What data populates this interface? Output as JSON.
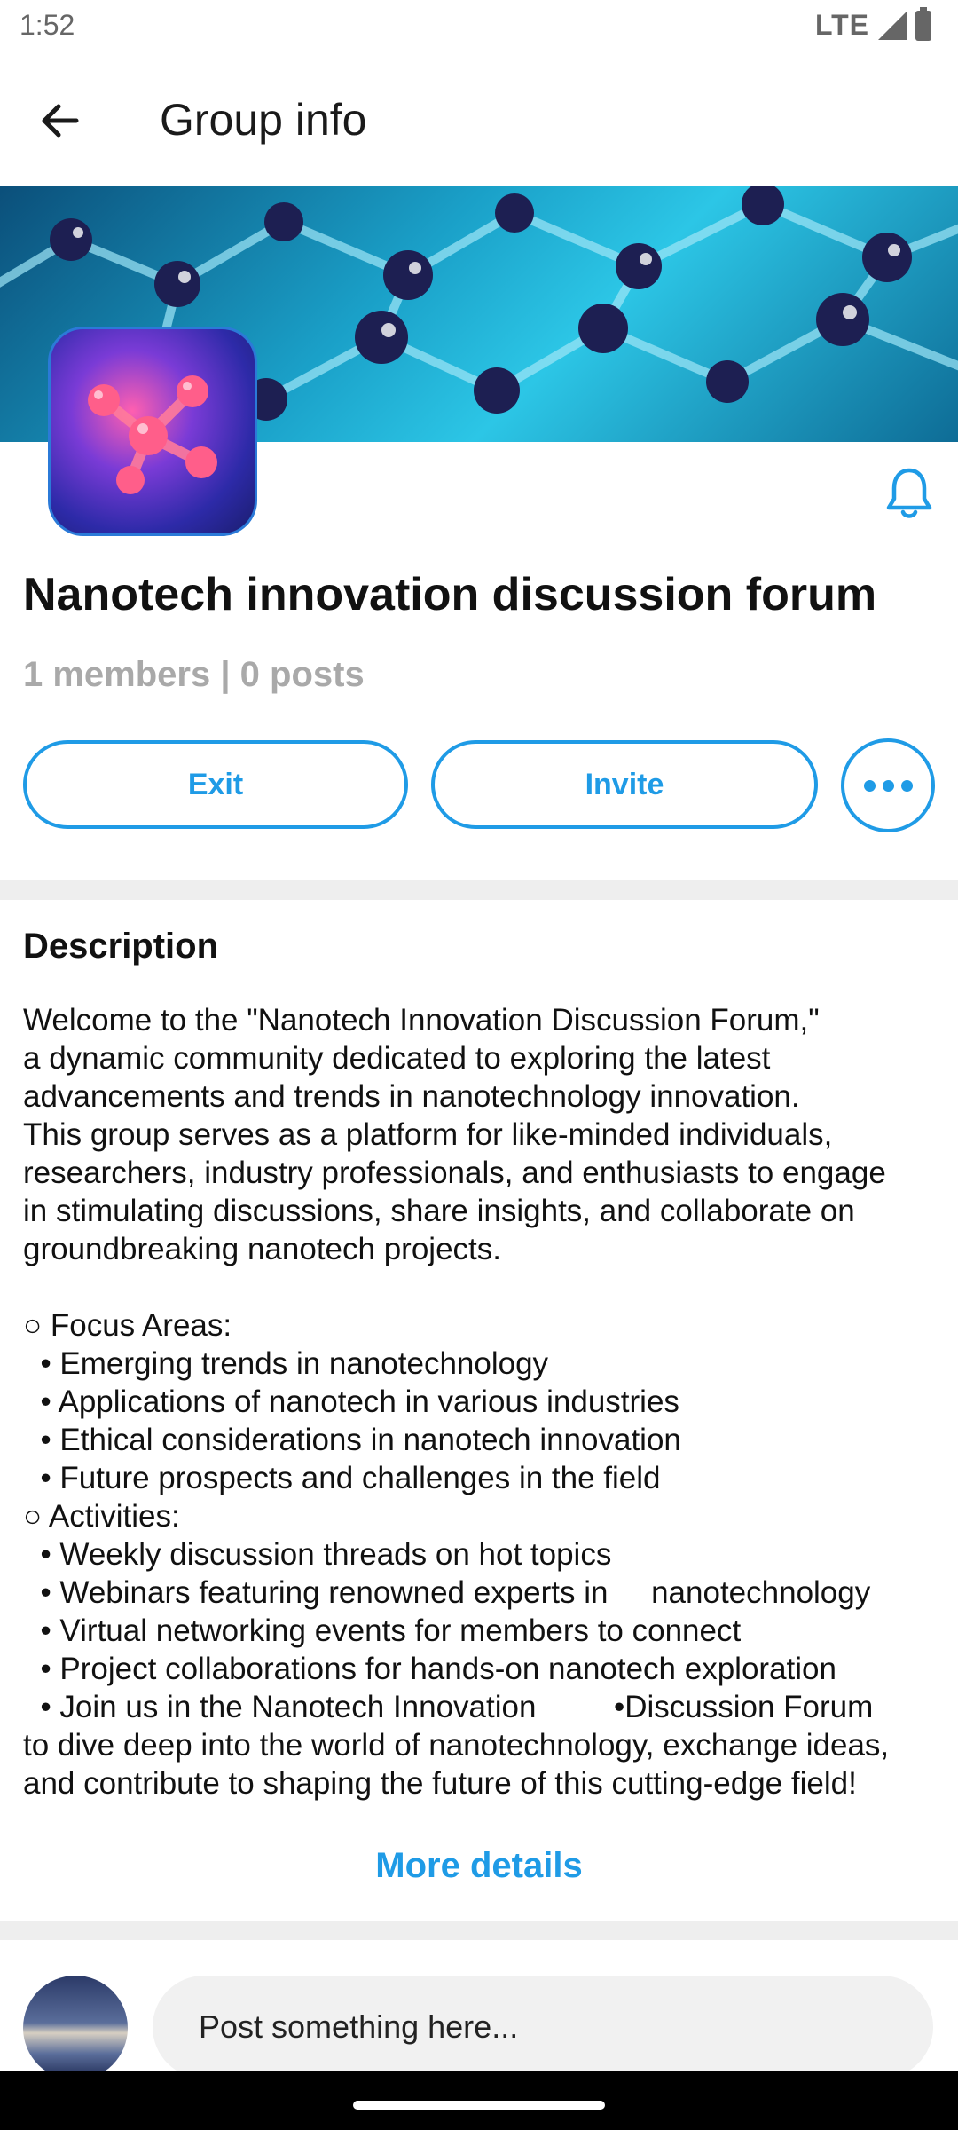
{
  "status_bar": {
    "time": "1:52",
    "network": "LTE"
  },
  "app_bar": {
    "title": "Group info",
    "back_icon": "arrow-left-icon"
  },
  "group": {
    "name": "Nanotech innovation discussion forum",
    "counts": "1 members | 0 posts",
    "bell_icon": "bell-icon"
  },
  "actions": {
    "exit_label": "Exit",
    "invite_label": "Invite",
    "more_icon": "more-horizontal-icon"
  },
  "description": {
    "title": "Description",
    "text": "Welcome to the \"Nanotech Innovation Discussion Forum,\"\na dynamic community dedicated to exploring the latest\nadvancements and trends in nanotechnology innovation.\nThis group serves as a platform for like-minded individuals,\nresearchers, industry professionals, and enthusiasts to engage\nin stimulating discussions, share insights, and collaborate on\ngroundbreaking nanotech projects.\n\n○ Focus Areas:\n  • Emerging trends in nanotechnology\n  • Applications of nanotech in various industries\n  • Ethical considerations in nanotech innovation\n  • Future prospects and challenges in the field\n○ Activities:\n  • Weekly discussion threads on hot topics\n  • Webinars featuring renowned experts in     nanotechnology\n  • Virtual networking events for members to connect\n  • Project collaborations for hands-on nanotech exploration\n  • Join us in the Nanotech Innovation         •Discussion Forum\nto dive deep into the world of nanotechnology, exchange ideas,\nand contribute to shaping the future of this cutting-edge field!",
    "more_label": "More details"
  },
  "composer": {
    "placeholder": "Post something here..."
  },
  "colors": {
    "accent": "#1f9be6",
    "muted_text": "#a9a9a9",
    "separator": "#eeeeee"
  }
}
